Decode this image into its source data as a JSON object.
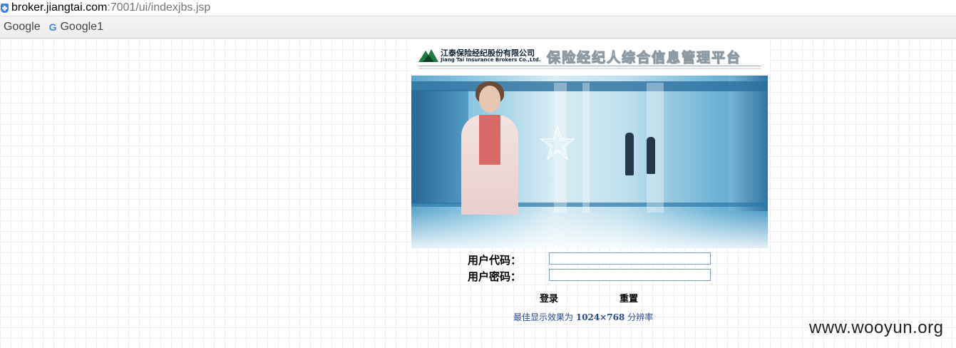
{
  "browser": {
    "url_host": "broker.jiangtai.com",
    "url_path": ":7001/ui/indexjbs.jsp",
    "bookmarks": [
      {
        "label": "Google"
      },
      {
        "label": "Google1"
      }
    ]
  },
  "banner": {
    "company_cn": "江泰保险经纪股份有限公司",
    "company_en": "Jiang Tai Insurance Brokers Co.,Ltd.",
    "platform_title": "保险经纪人综合信息管理平台"
  },
  "login": {
    "user_code_label": "用户代码：",
    "user_code_value": "",
    "password_label": "用户密码：",
    "password_value": "",
    "login_button": "登录",
    "reset_button": "重置",
    "resolution_prefix": "最佳显示效果为",
    "resolution_value": "1024×768",
    "resolution_suffix": "分辨率"
  },
  "watermark": "www.wooyun.org",
  "colors": {
    "link_blue": "#2a4a8f",
    "photo_blue": "#5ea6cc",
    "logo_green": "#1f7a3f"
  }
}
